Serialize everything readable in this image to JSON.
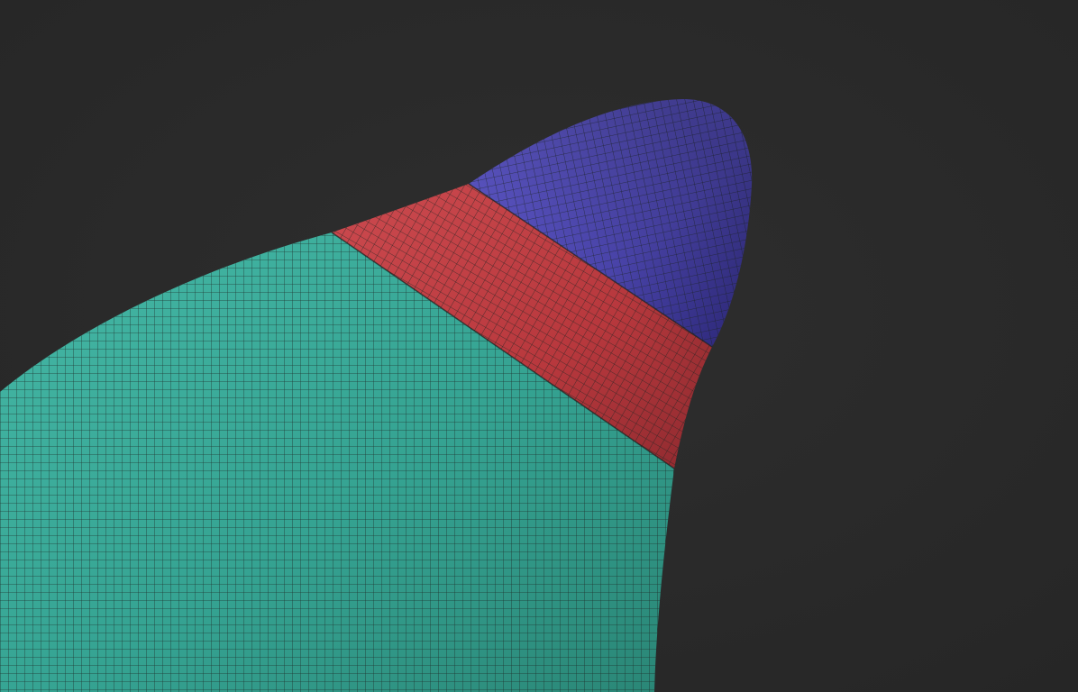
{
  "viewport": {
    "background_color": "#2e2e2e",
    "background_edge_color": "#262626"
  },
  "mesh": {
    "wire_color": "#1c2422",
    "polygroups": [
      {
        "id": "body",
        "color": "#35a392",
        "highlight": "#45b8a6",
        "shadow": "#2a8676"
      },
      {
        "id": "band",
        "color": "#b8383d",
        "highlight": "#cc4a4f",
        "shadow": "#8e2a2f"
      },
      {
        "id": "tip",
        "color": "#4b45ad",
        "highlight": "#5d57c4",
        "shadow": "#2f2a80"
      }
    ]
  }
}
